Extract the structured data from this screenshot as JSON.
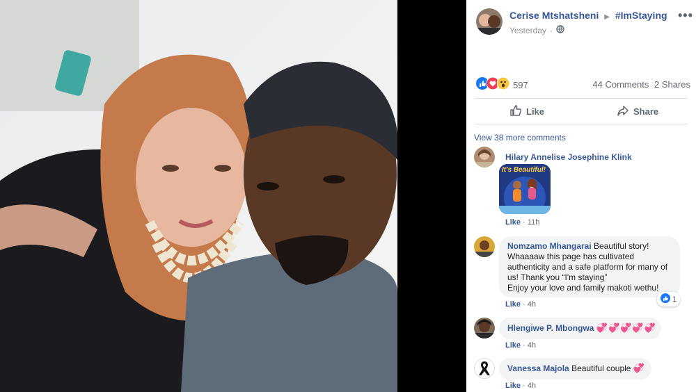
{
  "post": {
    "author": "Cerise Mtshatsheni",
    "group": "#ImStaying",
    "time": "Yesterday",
    "more_icon": "ellipsis-icon",
    "reactions_count": "597",
    "comments_count": "44 Comments",
    "shares_count": "2 Shares",
    "like_label": "Like",
    "share_label": "Share",
    "view_more": "View 38 more comments"
  },
  "comments": [
    {
      "name": "Hilary Annelise Josephine Klink",
      "sticker_text": "It's Beautiful!",
      "like_label": "Like",
      "time": "11h"
    },
    {
      "name": "Nomzamo Mhangarai",
      "text": "Beautiful story! Whaaaaw this page has cultivated authenticity and a safe platform for many of us! Thank you “I'm staying”\nEnjoy your love and family makoti wethu!",
      "line1": "Beautiful story!",
      "line2": "Whaaaaw this page has cultivated",
      "line3": "authenticity and a safe platform for many of",
      "line4": "us! Thank you “I'm staying”",
      "line5": "Enjoy your love and family makoti wethu!",
      "reaction_count": "1",
      "like_label": "Like",
      "time": "4h"
    },
    {
      "name": "Hlengiwe P. Mbongwa",
      "emoji": "💞💞💞💞💞",
      "like_label": "Like",
      "time": "4h"
    },
    {
      "name": "Vanessa Majola",
      "text": "Beautiful couple",
      "emoji": "💞",
      "like_label": "Like",
      "time": "4h"
    }
  ],
  "colors": {
    "link": "#385898",
    "like_blue": "#1877f2",
    "love_red": "#f33e58",
    "bubble": "#f2f3f5"
  }
}
